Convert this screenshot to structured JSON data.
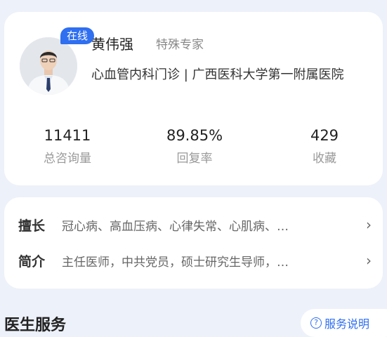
{
  "doctor": {
    "name": "黄伟强",
    "title": "特殊专家",
    "status_badge": "在线",
    "department": "心血管内科门诊 | 广西医科大学第一附属医院"
  },
  "stats": [
    {
      "value": "11411",
      "label": "总咨询量"
    },
    {
      "value": "89.85%",
      "label": "回复率"
    },
    {
      "value": "429",
      "label": "收藏"
    }
  ],
  "intro": {
    "specialty_label": "擅长",
    "specialty_text": "冠心病、高血压病、心律失常、心肌病、…",
    "bio_label": "简介",
    "bio_text": "主任医师，中共党员，硕士研究生导师，…"
  },
  "services": {
    "title": "医生服务",
    "help_label": "服务说明",
    "help_icon": "question-circle-icon"
  }
}
